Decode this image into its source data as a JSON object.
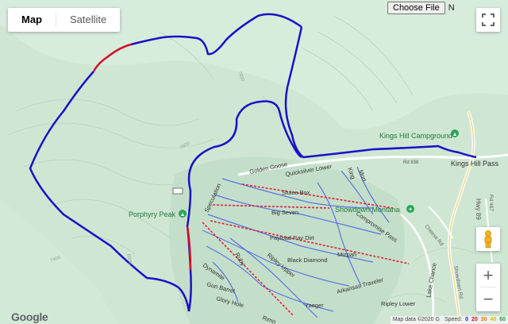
{
  "controls": {
    "map_label": "Map",
    "satellite_label": "Satellite",
    "choose_file_label": "Choose File",
    "file_status": "N",
    "zoom_in": "+",
    "zoom_out": "−"
  },
  "labels": {
    "campground": "Kings Hill Campground",
    "pass": "Kings Hill Pass",
    "peak": "Porphyry Peak",
    "resort": "Showdown Montana",
    "highway": "Hwy 89",
    "road": "Rd 838"
  },
  "runs": [
    "Golden Goose",
    "Quicksilver Lower",
    "Sluice Box",
    "Big Seven",
    "Payload Pay Dirt",
    "Compromise Pass",
    "Black Diamond",
    "Mizpah",
    "Speculation",
    "Ruby",
    "Ripley Upper",
    "Dynamite",
    "Gun Barrel",
    "Glory Hole",
    "Arkansas Traveler",
    "Ripley Lower",
    "Lake Chance",
    "Mort",
    "King",
    "Rimo",
    "Yaeger"
  ],
  "side_roads": [
    "Rd 487",
    "Showdown Rd",
    "Cheese Rd"
  ],
  "contours": [
    "7600",
    "7800",
    "8000",
    "7400"
  ],
  "footer": {
    "google": "Google",
    "map_data": "Map data ©2020 G",
    "speed_label": "Speed:",
    "speed_values": [
      "0",
      "20",
      "30",
      "40",
      "60"
    ]
  },
  "colors": {
    "track_blue": "#1a10c8",
    "track_red": "#d0102a",
    "lift_red": "#e0203a",
    "run_blue": "#5a74e0",
    "terrain": "#cfe6d3"
  }
}
